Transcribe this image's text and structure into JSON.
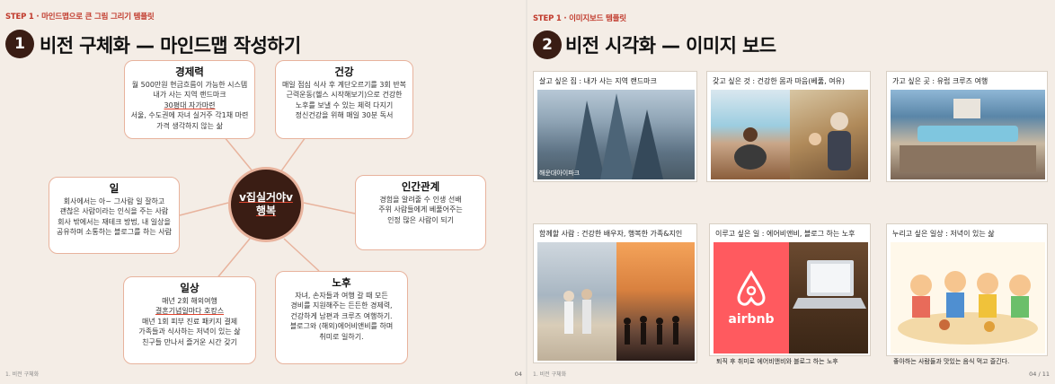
{
  "left": {
    "step": "STEP 1 · 마인드맵으로 큰 그림 그리기 템플릿",
    "number": "1",
    "title": "비전 구체화 — 마인드맵 작성하기",
    "center": {
      "line1": "v집실거야v",
      "line2": "행복"
    },
    "cards": {
      "economy": {
        "heading": "경제력",
        "lines": [
          "월 500만원 현금흐름이 가능한 시스템",
          "내가 사는 지역 랜드마크",
          "30평대 자가마련",
          "서울, 수도권에 자녀 실거주 각1채 마련",
          "가격 생각하지 않는 삶"
        ]
      },
      "health": {
        "heading": "건강",
        "lines": [
          "매일 점심 식사 후 계단오르기를 3회 반복",
          "근력운동(헬스 시작해보기)으로 건강한",
          "노후를 보낼 수 있는 체력 다지기",
          "정신건강을 위해 매일 30분 독서"
        ]
      },
      "work": {
        "heading": "일",
        "lines": [
          "회사에서는 아~ 그사람 일 잘하고",
          "괜찮은 사람이라는 인식을 주는 사람",
          "회사 밖에서는 재테크 방법, 내 일상을",
          "공유하며 소통하는 블로그를 하는 사람"
        ]
      },
      "relations": {
        "heading": "인간관계",
        "lines": [
          "경험을 알려줄 수 인생 선배",
          "주위 사람들에게 베풀어주는",
          "인정 많은 사람이 되기"
        ]
      },
      "daily": {
        "heading": "일상",
        "lines": [
          "매년 2회 해외여행",
          "결혼기념일마다 호캉스",
          "매년 1회 피부 진료 패키지 결제",
          "가족들과 식사하는 저녁이 있는 삶",
          "친구들 만나서 즐거운 시간 갖기"
        ]
      },
      "retire": {
        "heading": "노후",
        "lines": [
          "자녀, 손자들과 여행 갈 때 모든",
          "경비를 지원해주는 든든한 경제력,",
          "건강하게 남편과 크루즈 여행하기.",
          "블로그와 (해외)에어비앤비를 하며",
          "취미로 일하기."
        ]
      }
    },
    "footer": "1. 비전 구체화",
    "page": "04"
  },
  "right": {
    "step": "STEP 1 · 이미지보드 템플릿",
    "number": "2",
    "title": "비전 시각화 — 이미지 보드",
    "boards": [
      {
        "title": "살고 싶은 집 : 내가 사는 지역 랜드마크",
        "overlay": "해운대아이파크",
        "caption": ""
      },
      {
        "title": "갖고 싶은 것 : 건강한 몸과 마음(베풂, 여유)",
        "caption": ""
      },
      {
        "title": "가고 싶은 곳 : 유럽 크루즈 여행",
        "caption": ""
      },
      {
        "title": "함께할 사람 : 건강한 배우자, 행복한 가족&지인",
        "caption": ""
      },
      {
        "title": "이루고 싶은 일 : 에어비앤비, 블로그 하는 노후",
        "caption": "퇴직 후 취미로 에어비앤비와 블로그 하는 노후",
        "logo": "airbnb"
      },
      {
        "title": "누리고 싶은 일상 : 저녁이 있는 삶",
        "caption": "좋아하는 사람들과 맛있는 음식 먹고 즐긴다."
      }
    ],
    "footer": "1. 비전 구체화",
    "page": "04 / 11"
  },
  "colors": {
    "accent": "#c0392b",
    "card_border": "#e8b39d",
    "dark": "#3a1d14",
    "slide_bg": "#f4ede6"
  },
  "icons": [
    "airbnb-logo"
  ]
}
